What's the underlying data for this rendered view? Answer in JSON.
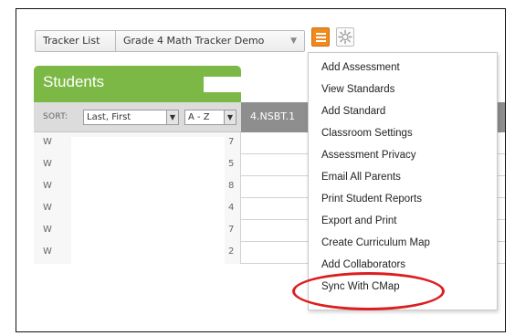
{
  "toolbar": {
    "tracker_list": "Tracker List",
    "tracker_name": "Grade 4 Math Tracker Demo",
    "menu_icon": "hamburger-menu-icon",
    "settings_icon": "gear-icon",
    "accent_color": "#f08a1f"
  },
  "students_panel": {
    "title": "Students",
    "sort_label": "SORT:",
    "sort_field": "Last, First",
    "sort_order": "A - Z",
    "header_color": "#7cb846"
  },
  "standards": {
    "columns": [
      "4.NSBT.1"
    ]
  },
  "rows": [
    {
      "initial": "W",
      "trailing": "7"
    },
    {
      "initial": "W",
      "trailing": "5"
    },
    {
      "initial": "W",
      "trailing": "8"
    },
    {
      "initial": "W",
      "trailing": "4"
    },
    {
      "initial": "W",
      "trailing": "7"
    },
    {
      "initial": "W",
      "trailing": "2"
    }
  ],
  "menu": {
    "items": [
      "Add Assessment",
      "View Standards",
      "Add Standard",
      "Classroom Settings",
      "Assessment Privacy",
      "Email All Parents",
      "Print Student Reports",
      "Export and Print",
      "Create Curriculum Map",
      "Add Collaborators",
      "Sync With CMap"
    ],
    "highlighted": "Sync With CMap",
    "highlight_color": "#dc1e1e"
  }
}
